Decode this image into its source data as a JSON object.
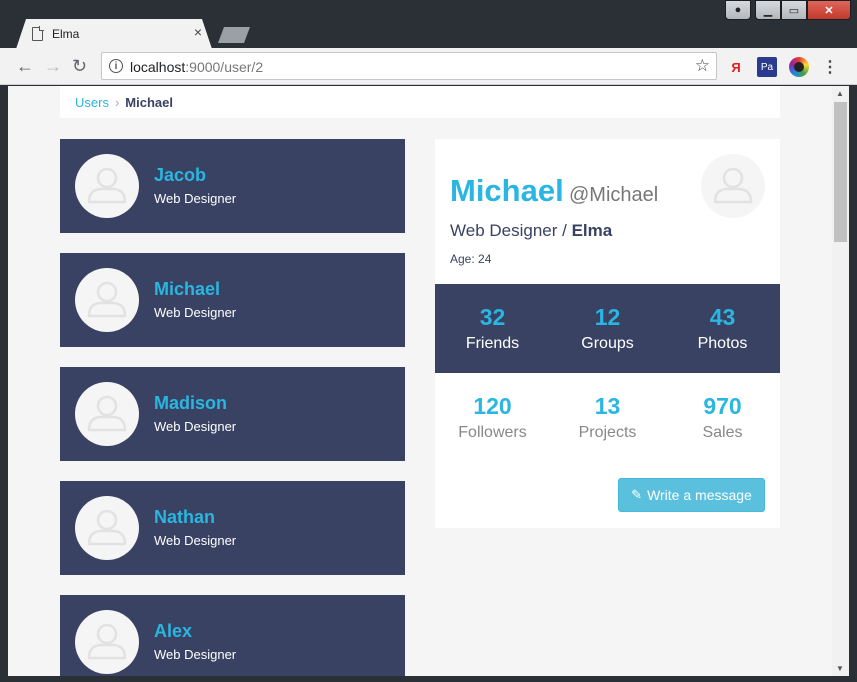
{
  "browser": {
    "tab_title": "Elma",
    "tab_close": "×",
    "url_host": "localhost",
    "url_path": ":9000/user/2",
    "ext_yandex": "Я",
    "ext_photo": "Pa"
  },
  "breadcrumb": {
    "link": "Users",
    "separator": "›",
    "current": "Michael"
  },
  "users": [
    {
      "name": "Jacob",
      "role": "Web Designer"
    },
    {
      "name": "Michael",
      "role": "Web Designer"
    },
    {
      "name": "Madison",
      "role": "Web Designer"
    },
    {
      "name": "Nathan",
      "role": "Web Designer"
    },
    {
      "name": "Alex",
      "role": "Web Designer"
    }
  ],
  "profile": {
    "name": "Michael",
    "handle": "@Michael",
    "role": "Web Designer",
    "role_sep": " / ",
    "company": "Elma",
    "age": "Age: 24",
    "stats_primary": [
      {
        "value": "32",
        "label": "Friends"
      },
      {
        "value": "12",
        "label": "Groups"
      },
      {
        "value": "43",
        "label": "Photos"
      }
    ],
    "stats_secondary": [
      {
        "value": "120",
        "label": "Followers"
      },
      {
        "value": "13",
        "label": "Projects"
      },
      {
        "value": "970",
        "label": "Sales"
      }
    ],
    "message_button": "Write a message"
  },
  "colors": {
    "card_bg": "#394263",
    "accent": "#29b6e0",
    "button": "#5bc0de"
  }
}
